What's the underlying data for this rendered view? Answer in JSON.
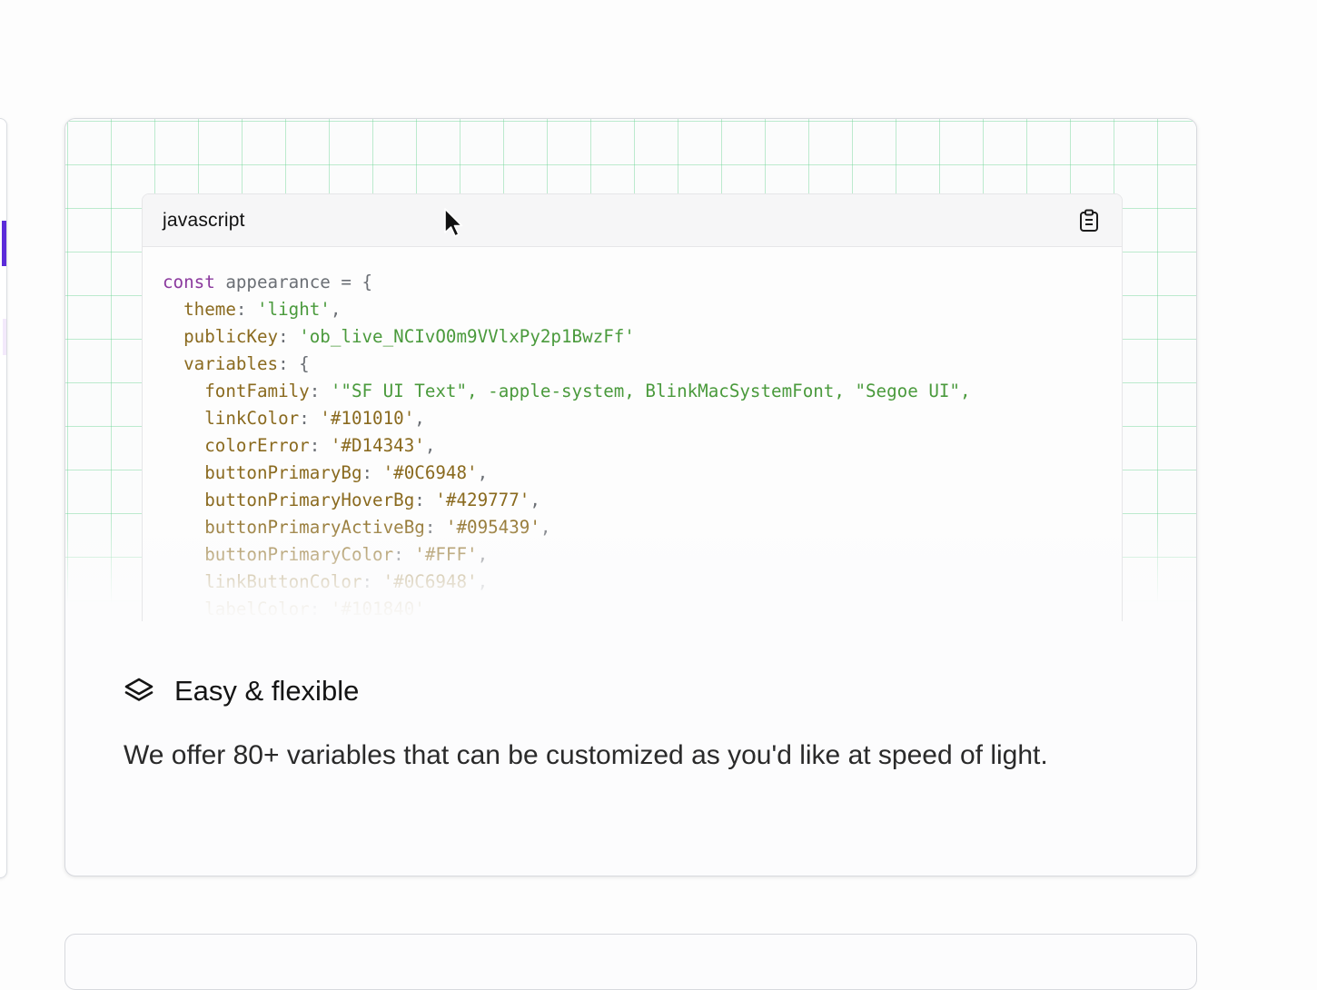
{
  "code_block": {
    "language": "javascript",
    "copy_icon": "clipboard-icon",
    "lines": [
      [
        {
          "t": "kw",
          "v": "const"
        },
        {
          "t": "punc",
          "v": " appearance = {"
        }
      ],
      [
        {
          "t": "punc",
          "v": "  "
        },
        {
          "t": "key",
          "v": "theme"
        },
        {
          "t": "punc",
          "v": ": "
        },
        {
          "t": "str",
          "v": "'light'"
        },
        {
          "t": "punc",
          "v": ","
        }
      ],
      [
        {
          "t": "punc",
          "v": "  "
        },
        {
          "t": "key",
          "v": "publicKey"
        },
        {
          "t": "punc",
          "v": ": "
        },
        {
          "t": "str",
          "v": "'ob_live_NCIvO0m9VVlxPy2p1BwzFf'"
        }
      ],
      [
        {
          "t": "punc",
          "v": "  "
        },
        {
          "t": "key",
          "v": "variables"
        },
        {
          "t": "punc",
          "v": ": {"
        }
      ],
      [
        {
          "t": "punc",
          "v": "    "
        },
        {
          "t": "key",
          "v": "fontFamily"
        },
        {
          "t": "punc",
          "v": ": "
        },
        {
          "t": "str",
          "v": "'\"SF UI Text\", -apple-system, BlinkMacSystemFont, \"Segoe UI\","
        }
      ],
      [
        {
          "t": "punc",
          "v": "    "
        },
        {
          "t": "key",
          "v": "linkColor"
        },
        {
          "t": "punc",
          "v": ": "
        },
        {
          "t": "key",
          "v": "'#101010'"
        },
        {
          "t": "punc",
          "v": ","
        }
      ],
      [
        {
          "t": "punc",
          "v": "    "
        },
        {
          "t": "key",
          "v": "colorError"
        },
        {
          "t": "punc",
          "v": ": "
        },
        {
          "t": "key",
          "v": "'#D14343'"
        },
        {
          "t": "punc",
          "v": ","
        }
      ],
      [
        {
          "t": "punc",
          "v": "    "
        },
        {
          "t": "key",
          "v": "buttonPrimaryBg"
        },
        {
          "t": "punc",
          "v": ": "
        },
        {
          "t": "key",
          "v": "'#0C6948'"
        },
        {
          "t": "punc",
          "v": ","
        }
      ],
      [
        {
          "t": "punc",
          "v": "    "
        },
        {
          "t": "key",
          "v": "buttonPrimaryHoverBg"
        },
        {
          "t": "punc",
          "v": ": "
        },
        {
          "t": "key",
          "v": "'#429777'"
        },
        {
          "t": "punc",
          "v": ","
        }
      ],
      [
        {
          "t": "punc",
          "v": "    "
        },
        {
          "t": "key",
          "v": "buttonPrimaryActiveBg"
        },
        {
          "t": "punc",
          "v": ": "
        },
        {
          "t": "key",
          "v": "'#095439'"
        },
        {
          "t": "punc",
          "v": ","
        }
      ],
      [
        {
          "t": "punc",
          "v": "    "
        },
        {
          "t": "key",
          "v": "buttonPrimaryColor"
        },
        {
          "t": "punc",
          "v": ": "
        },
        {
          "t": "key",
          "v": "'#FFF'"
        },
        {
          "t": "punc",
          "v": ","
        }
      ],
      [
        {
          "t": "punc",
          "v": "    "
        },
        {
          "t": "key",
          "v": "linkButtonColor"
        },
        {
          "t": "punc",
          "v": ": "
        },
        {
          "t": "key",
          "v": "'#0C6948'"
        },
        {
          "t": "punc",
          "v": ","
        }
      ],
      [
        {
          "t": "punc",
          "v": "    "
        },
        {
          "t": "key",
          "v": "labelColor"
        },
        {
          "t": "punc",
          "v": ": "
        },
        {
          "t": "key",
          "v": "'#101840'"
        }
      ]
    ]
  },
  "feature": {
    "icon": "layers-icon",
    "title": "Easy & flexible",
    "description": "We offer 80+ variables that can be customized as you'd like at speed of light."
  },
  "colors": {
    "keyword": "#8b3a9e",
    "property": "#8a6a1f",
    "string": "#4a9a3c",
    "grid": "#6ed696",
    "accent": "#5b2bd9"
  }
}
